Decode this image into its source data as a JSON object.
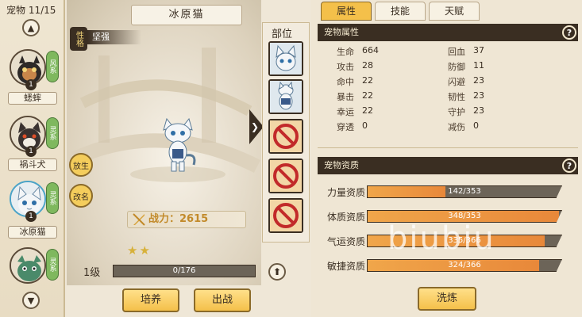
{
  "pet_list": {
    "count_label": "宠物 11/15",
    "up_icon": "chevron-up-icon",
    "down_icon": "chevron-down-icon",
    "pets": [
      {
        "name": "",
        "level": "1",
        "tag": "风系",
        "tag_color": "#7fb85e"
      },
      {
        "name": "蟋蟀",
        "level": "1",
        "tag": "灵系",
        "tag_color": "#7fb85e"
      },
      {
        "name": "祸斗犬",
        "level": "1",
        "tag": "灵系",
        "tag_color": "#7fb85e"
      },
      {
        "name": "冰原猫",
        "level": "1",
        "tag": "灵系",
        "tag_color": "#7fb85e"
      }
    ]
  },
  "center": {
    "pet_title": "冰原猫",
    "personality_label": "性格",
    "personality_value": "坚强",
    "release_button": "放生",
    "rename_button": "改名",
    "power_label": "战力：2615",
    "stars": 2,
    "level_label": "1级",
    "exp_text": "0/176",
    "exp_progress": 0.0,
    "train_button": "培养",
    "battle_button": "出战"
  },
  "equip": {
    "title": "部位",
    "slots": [
      {
        "state": "pet",
        "icon": "cat-portrait-icon"
      },
      {
        "state": "pet",
        "icon": "cat-fullbody-icon"
      },
      {
        "state": "locked",
        "icon": "forbidden-icon"
      },
      {
        "state": "locked",
        "icon": "forbidden-icon"
      },
      {
        "state": "locked",
        "icon": "forbidden-icon"
      }
    ]
  },
  "tabs": [
    "属性",
    "技能",
    "天赋"
  ],
  "active_tab": 0,
  "attributes": {
    "title": "宠物属性",
    "left": [
      {
        "name": "生命",
        "value": "664"
      },
      {
        "name": "攻击",
        "value": "28"
      },
      {
        "name": "命中",
        "value": "22"
      },
      {
        "name": "暴击",
        "value": "22"
      },
      {
        "name": "幸运",
        "value": "22"
      },
      {
        "name": "穿透",
        "value": "0"
      }
    ],
    "right": [
      {
        "name": "回血",
        "value": "37"
      },
      {
        "name": "防御",
        "value": "11"
      },
      {
        "name": "闪避",
        "value": "23"
      },
      {
        "name": "韧性",
        "value": "23"
      },
      {
        "name": "守护",
        "value": "23"
      },
      {
        "name": "减伤",
        "value": "0"
      }
    ]
  },
  "aptitude": {
    "title": "宠物资质",
    "rows": [
      {
        "name": "力量资质",
        "text": "142/353",
        "ratio": 0.4023
      },
      {
        "name": "体质资质",
        "text": "348/353",
        "ratio": 0.9858
      },
      {
        "name": "气运资质",
        "text": "335/366",
        "ratio": 0.9153
      },
      {
        "name": "敏捷资质",
        "text": "324/366",
        "ratio": 0.8852
      }
    ],
    "wash_button": "洗炼"
  },
  "watermark": "biubiu"
}
